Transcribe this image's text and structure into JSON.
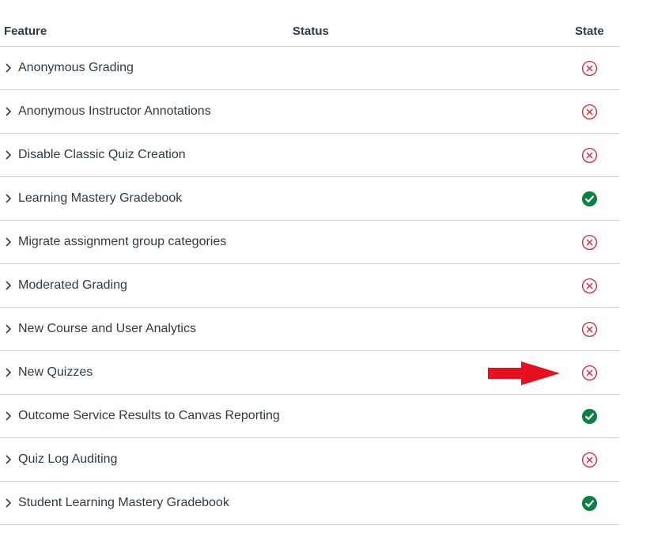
{
  "colors": {
    "off": "#d0283e",
    "on": "#0b8043",
    "annotation_arrow": "#e8101e",
    "text": "#2d3b45",
    "divider": "#c7cdd1"
  },
  "table": {
    "headers": {
      "feature": "Feature",
      "status": "Status",
      "state": "State"
    },
    "rows": [
      {
        "name": "Anonymous Grading",
        "status": "",
        "state": "off",
        "state_icon": "x-circle-icon"
      },
      {
        "name": "Anonymous Instructor Annotations",
        "status": "",
        "state": "off",
        "state_icon": "x-circle-icon"
      },
      {
        "name": "Disable Classic Quiz Creation",
        "status": "",
        "state": "off",
        "state_icon": "x-circle-icon"
      },
      {
        "name": "Learning Mastery Gradebook",
        "status": "",
        "state": "on",
        "state_icon": "check-circle-icon"
      },
      {
        "name": "Migrate assignment group categories",
        "status": "",
        "state": "off",
        "state_icon": "x-circle-icon"
      },
      {
        "name": "Moderated Grading",
        "status": "",
        "state": "off",
        "state_icon": "x-circle-icon"
      },
      {
        "name": "New Course and User Analytics",
        "status": "",
        "state": "off",
        "state_icon": "x-circle-icon"
      },
      {
        "name": "New Quizzes",
        "status": "",
        "state": "off",
        "state_icon": "x-circle-icon",
        "annotated": true
      },
      {
        "name": "Outcome Service Results to Canvas Reporting",
        "status": "",
        "state": "on",
        "state_icon": "check-circle-icon"
      },
      {
        "name": "Quiz Log Auditing",
        "status": "",
        "state": "off",
        "state_icon": "x-circle-icon"
      },
      {
        "name": "Student Learning Mastery Gradebook",
        "status": "",
        "state": "on",
        "state_icon": "check-circle-icon"
      }
    ]
  },
  "annotation": {
    "type": "arrow-right-icon",
    "target_row": "New Quizzes"
  }
}
